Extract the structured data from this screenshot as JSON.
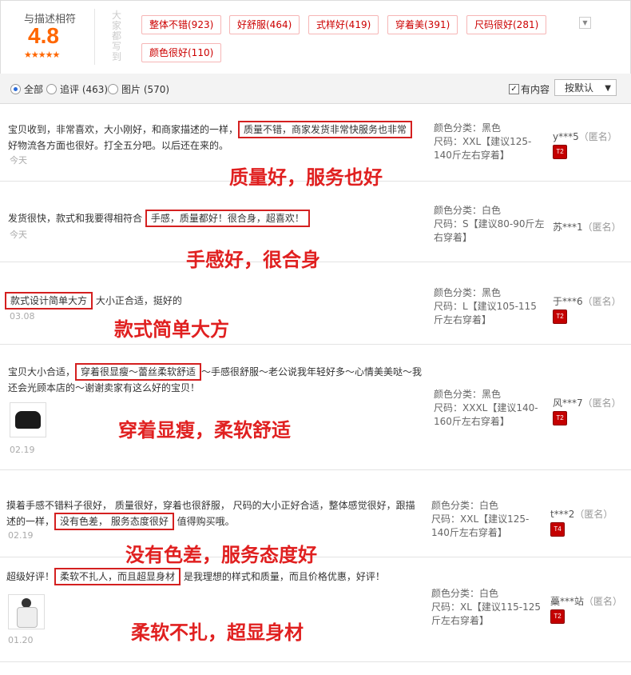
{
  "summary": {
    "title": "与描述相符",
    "score": "4.8",
    "stars": "★★★★★",
    "tags_label": "大家都写到",
    "tags": [
      "整体不错(923)",
      "好舒服(464)",
      "式样好(419)",
      "穿着美(391)",
      "尺码很好(281)",
      "颜色很好(110)"
    ],
    "toggle_icon": "chevron-down"
  },
  "filter": {
    "options": [
      {
        "label": "全部",
        "selected": true
      },
      {
        "label": "追评 (463)",
        "selected": false
      },
      {
        "label": "图片 (570)",
        "selected": false
      }
    ],
    "has_content_label": "有内容",
    "has_content_checked": true,
    "sort_label": "按默认"
  },
  "reviews": [
    {
      "pre": "宝贝收到，非常喜欢，大小刚好，和商家描述的一样，",
      "hl": "质量不错，商家发货非常快服务也非常",
      "post": "好物流各方面也很好。打全五分吧。以后还在来的。",
      "date": "今天",
      "annotation": "质量好，服务也好",
      "sku_color": "颜色分类：黑色",
      "sku_size": "尺码：XXL【建议125-140斤左右穿着】",
      "user": "y***5",
      "anon": "（匿名）",
      "level": "T2"
    },
    {
      "pre": "发货很快，款式和我要得相符合 ",
      "hl": "手感，质量都好！很合身，超喜欢！",
      "post": "",
      "date": "今天",
      "annotation": "手感好，很合身",
      "sku_color": "颜色分类：白色",
      "sku_size": "尺码：S【建议80-90斤左右穿着】",
      "user": "苏***1",
      "anon": "（匿名）",
      "level": ""
    },
    {
      "pre": "",
      "hl": "款式设计简单大方",
      "post": " 大小正合适，挺好的",
      "date": "03.08",
      "annotation": "款式简单大方",
      "sku_color": "颜色分类：黑色",
      "sku_size": "尺码：L【建议105-115斤左右穿着】",
      "user": "于***6",
      "anon": "（匿名）",
      "level": "T2"
    },
    {
      "pre": "宝贝大小合适，",
      "hl": "穿着很显瘦～蕾丝柔软舒适",
      "post": "～手感很舒服～老公说我年轻好多～心情美美哒～我还会光顾本店的～谢谢卖家有这么好的宝贝！",
      "date": "02.19",
      "annotation": "穿着显瘦，柔软舒适",
      "sku_color": "颜色分类：黑色",
      "sku_size": "尺码：XXXL【建议140-160斤左右穿着】",
      "user": "风***7",
      "anon": "（匿名）",
      "level": "T2"
    },
    {
      "pre": "摸着手感不错料子很好， 质量很好，穿着也很舒服， 尺码的大小正好合适，整体感觉很好，跟描述的一样，",
      "hl": "没有色差， 服务态度很好",
      "post": " 值得购买哦。",
      "date": "02.19",
      "annotation": "没有色差，服务态度好",
      "sku_color": "颜色分类：白色",
      "sku_size": "尺码：XXL【建议125-140斤左右穿着】",
      "user": "t***2",
      "anon": "（匿名）",
      "level": "T4"
    },
    {
      "pre": "超级好评！",
      "hl": "柔软不扎人，而且超显身材",
      "post": " 是我理想的样式和质量，而且价格优惠，好评！",
      "date": "01.20",
      "annotation": "柔软不扎，超显身材",
      "sku_color": "颜色分类：白色",
      "sku_size": "尺码：XL【建议115-125斤左右穿着】",
      "user": "蘽***站",
      "anon": "（匿名）",
      "level": "T2"
    }
  ],
  "colors": {
    "accent": "#ff6600",
    "tag_text": "#cc0000",
    "annotation": "#e02020",
    "highlight_box": "#d42020"
  }
}
